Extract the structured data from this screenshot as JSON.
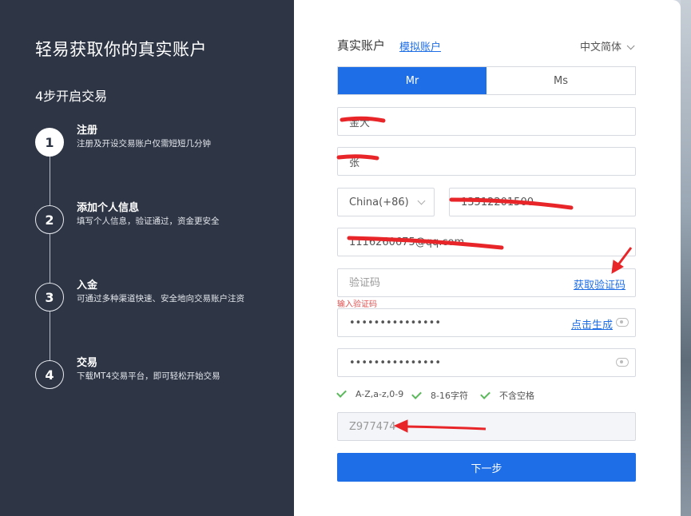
{
  "left": {
    "title": "轻易获取你的真实账户",
    "subtitle": "4步开启交易",
    "steps": [
      {
        "num": "1",
        "title": "注册",
        "desc": "注册及开设交易账户仅需短短几分钟"
      },
      {
        "num": "2",
        "title": "添加个人信息",
        "desc": "填写个人信息，验证通过，资金更安全"
      },
      {
        "num": "3",
        "title": "入金",
        "desc": "可通过多种渠道快速、安全地向交易账户注资"
      },
      {
        "num": "4",
        "title": "交易",
        "desc": "下载MT4交易平台，即可轻松开始交易"
      }
    ]
  },
  "form": {
    "tab_real": "真实账户",
    "tab_demo": "模拟账户",
    "language": "中文简体",
    "gender": {
      "mr": "Mr",
      "ms": "Ms",
      "selected": "Mr"
    },
    "first_name": "金大",
    "last_name": "张",
    "country": "China(+86)",
    "phone": "13512201500",
    "email": "1116260675@qq.com",
    "code_placeholder": "验证码",
    "get_code_label": "获取验证码",
    "code_error": "输入验证码",
    "password": "•••••••••••••••",
    "generate_label": "点击生成",
    "password_confirm": "•••••••••••••••",
    "rules": [
      "A-Z,a-z,0-9",
      "8-16字符",
      "不含空格"
    ],
    "invite_code": "Z977474",
    "next_label": "下一步"
  },
  "colors": {
    "left_bg": "#2e3545",
    "accent": "#1e6ee8",
    "check": "#5cb85c",
    "error": "#e05050",
    "annotation": "#e8262a"
  }
}
